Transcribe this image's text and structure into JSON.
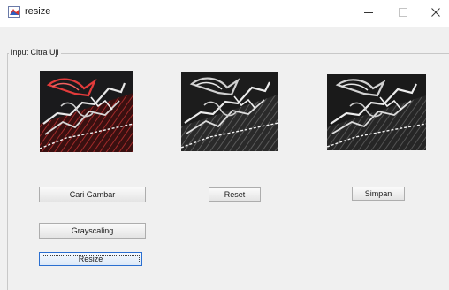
{
  "window": {
    "title": "resize",
    "controls": {
      "minimize_glyph": "—",
      "maximize_glyph": "☐",
      "close_glyph": "✕"
    }
  },
  "panel": {
    "title": "Input Citra Uji"
  },
  "images": [
    {
      "name": "original-color-image",
      "tone": "color"
    },
    {
      "name": "grayscale-image",
      "tone": "gray"
    },
    {
      "name": "resized-image",
      "tone": "gray"
    }
  ],
  "buttons": {
    "cari_gambar": "Cari Gambar",
    "reset": "Reset",
    "simpan": "Simpan",
    "grayscaling": "Grayscaling",
    "resize": "Resize"
  },
  "colors": {
    "window_bg": "#f0f0f0",
    "titlebar_bg": "#ffffff",
    "focus_border": "#2a6fd1"
  }
}
